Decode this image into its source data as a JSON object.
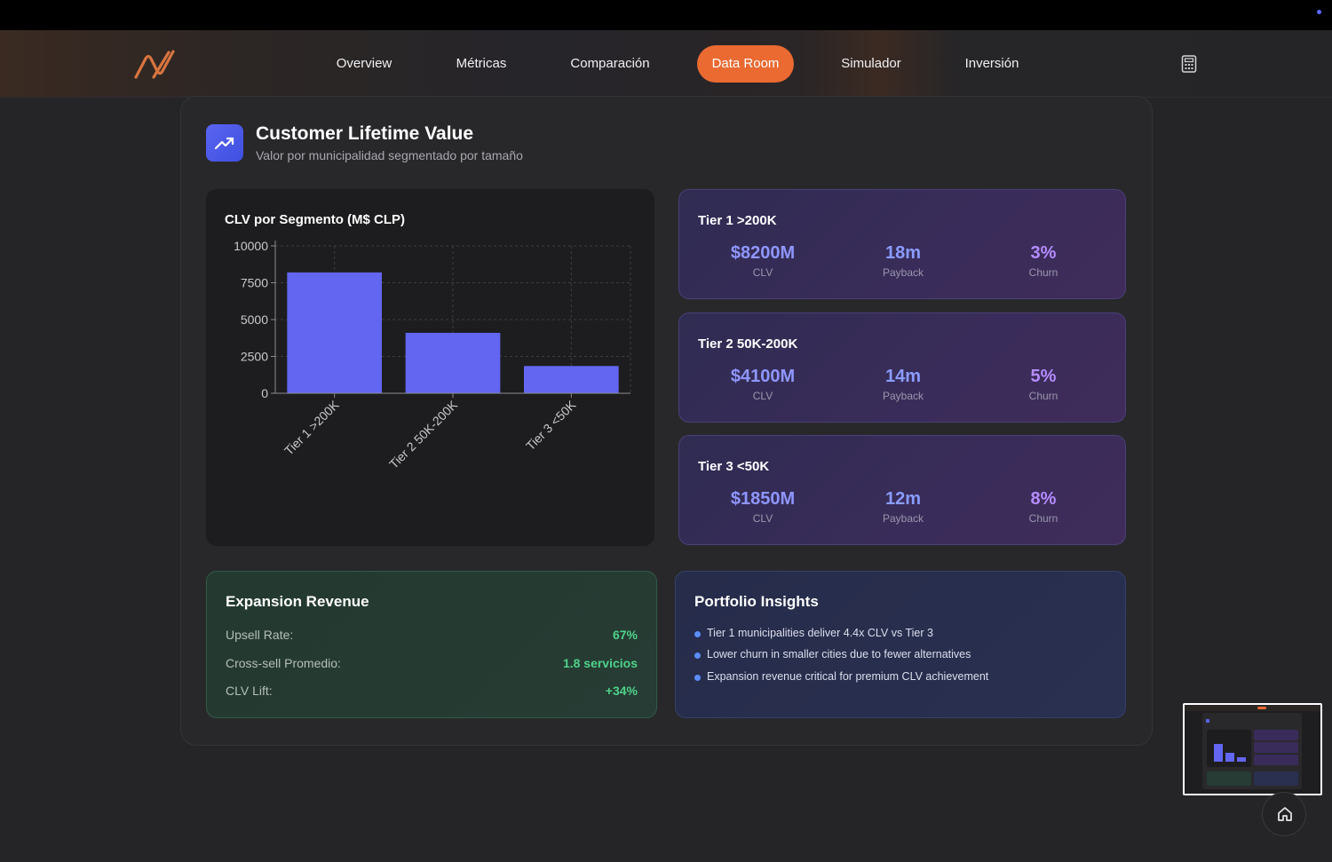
{
  "nav": {
    "items": [
      {
        "label": "Overview",
        "active": false
      },
      {
        "label": "Métricas",
        "active": false
      },
      {
        "label": "Comparación",
        "active": false
      },
      {
        "label": "Data Room",
        "active": true
      },
      {
        "label": "Simulador",
        "active": false
      },
      {
        "label": "Inversión",
        "active": false
      }
    ],
    "accent_color": "#ea6a32"
  },
  "header": {
    "title": "Customer Lifetime Value",
    "subtitle": "Valor por municipalidad segmentado por tamaño",
    "icon": "trending-up-icon"
  },
  "chart_data": {
    "type": "bar",
    "title": "CLV por Segmento (M$ CLP)",
    "categories": [
      "Tier 1 >200K",
      "Tier 2 50K-200K",
      "Tier 3 <50K"
    ],
    "values": [
      8200,
      4100,
      1850
    ],
    "yticks": [
      0,
      2500,
      5000,
      7500,
      10000
    ],
    "ylim": [
      0,
      10000
    ],
    "grid": true,
    "bar_color": "#6366f1"
  },
  "tiers": [
    {
      "name": "Tier 1 >200K",
      "clv": "$8200M",
      "clv_label": "CLV",
      "payback": "18m",
      "payback_label": "Payback",
      "churn": "3%",
      "churn_label": "Churn"
    },
    {
      "name": "Tier 2 50K-200K",
      "clv": "$4100M",
      "clv_label": "CLV",
      "payback": "14m",
      "payback_label": "Payback",
      "churn": "5%",
      "churn_label": "Churn"
    },
    {
      "name": "Tier 3 <50K",
      "clv": "$1850M",
      "clv_label": "CLV",
      "payback": "12m",
      "payback_label": "Payback",
      "churn": "8%",
      "churn_label": "Churn"
    }
  ],
  "expansion": {
    "title": "Expansion Revenue",
    "rows": [
      {
        "label": "Upsell Rate:",
        "value": "67%"
      },
      {
        "label": "Cross-sell Promedio:",
        "value": "1.8 servicios"
      },
      {
        "label": "CLV Lift:",
        "value": "+34%"
      }
    ]
  },
  "insights": {
    "title": "Portfolio Insights",
    "items": [
      "Tier 1 municipalities deliver 4.4x CLV vs Tier 3",
      "Lower churn in smaller cities due to fewer alternatives",
      "Expansion revenue critical for premium CLV achievement"
    ]
  }
}
